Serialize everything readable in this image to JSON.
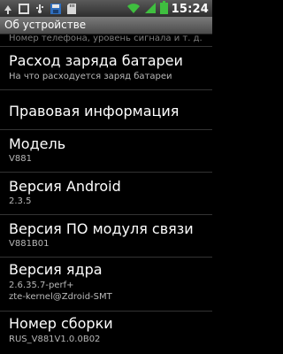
{
  "status_bar": {
    "time": "15:24",
    "left_icons": [
      "usb-debug-icon",
      "notification-icon",
      "usb-icon",
      "save-icon",
      "sd-card-icon"
    ],
    "right_icons": [
      "wifi-icon",
      "signal-icon",
      "battery-icon"
    ]
  },
  "header": {
    "title": "Об устройстве"
  },
  "list": {
    "partial_text": "Номер телефона, уровень сигнала и т. д.",
    "items": [
      {
        "title": "Расход заряда батареи",
        "subtitle": "На что расходуется заряд батареи"
      },
      {
        "title": "Правовая информация"
      },
      {
        "title": "Модель",
        "subtitle": "V881"
      },
      {
        "title": "Версия Android",
        "subtitle": "2.3.5"
      },
      {
        "title": "Версия ПО модуля связи",
        "subtitle": "V881B01"
      },
      {
        "title": "Версия ядра",
        "subtitle": "2.6.35.7-perf+",
        "subtitle2": "zte-kernel@Zdroid-SMT"
      },
      {
        "title": "Номер сборки",
        "subtitle": "RUS_V881V1.0.0B02"
      }
    ]
  }
}
